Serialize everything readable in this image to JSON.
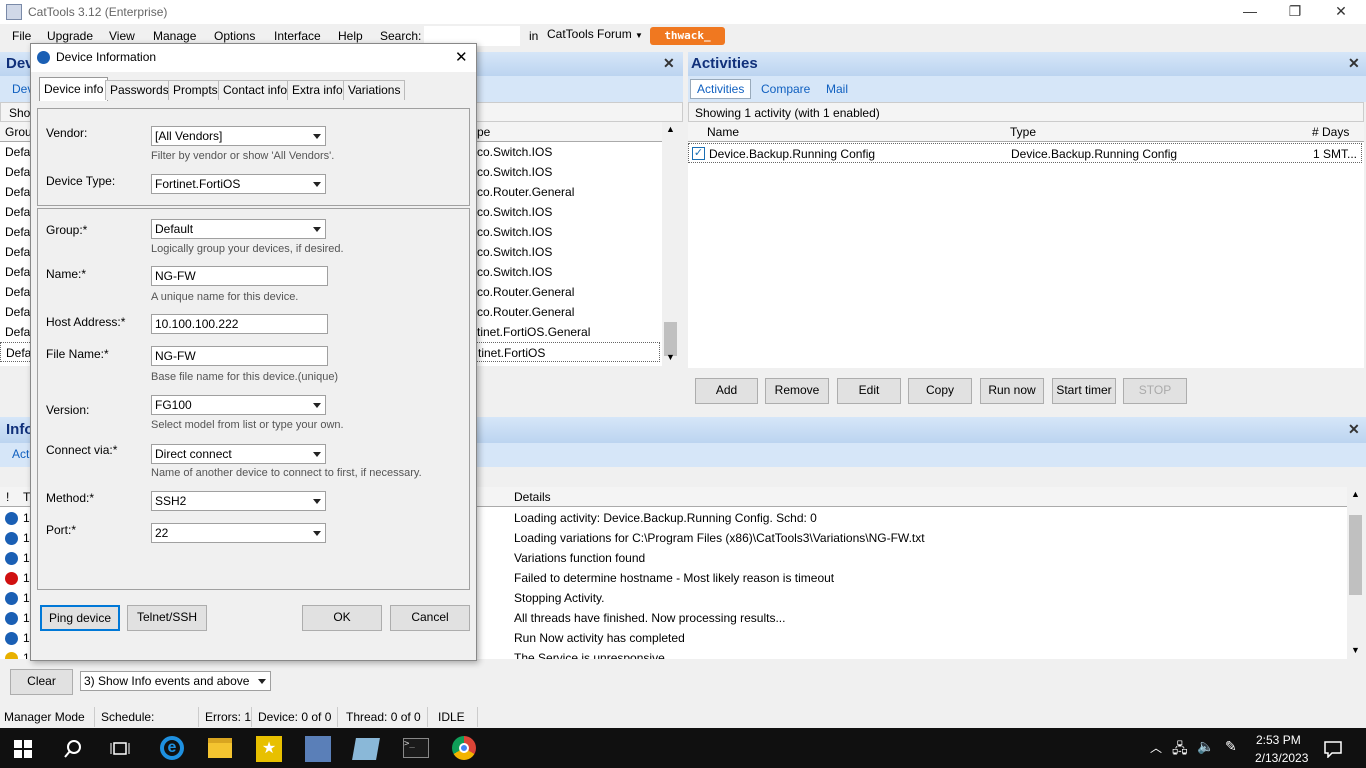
{
  "window": {
    "title": "CatTools 3.12 (Enterprise)",
    "minimize": "—",
    "restore": "❐",
    "close": "✕"
  },
  "menu": {
    "items": [
      "File",
      "Upgrade",
      "View",
      "Manage",
      "Options",
      "Interface",
      "Help"
    ],
    "search_label": "Search:",
    "search_value": "",
    "in_label": "in",
    "in_value": "CatTools Forum",
    "thwack": "thwack_"
  },
  "devices_pane": {
    "title": "Dev",
    "tab": "Dev",
    "show": "Show",
    "col_group": "Grou",
    "col_type": "pe",
    "rows": [
      {
        "group": "Defa",
        "type": "co.Switch.IOS"
      },
      {
        "group": "Defa",
        "type": "co.Switch.IOS"
      },
      {
        "group": "Defa",
        "type": "co.Router.General"
      },
      {
        "group": "Defa",
        "type": "co.Switch.IOS"
      },
      {
        "group": "Defa",
        "type": "co.Switch.IOS"
      },
      {
        "group": "Defa",
        "type": "co.Switch.IOS"
      },
      {
        "group": "Defa",
        "type": "co.Switch.IOS"
      },
      {
        "group": "Defa",
        "type": "co.Router.General"
      },
      {
        "group": "Defa",
        "type": "co.Router.General"
      },
      {
        "group": "Defa",
        "type": "tinet.FortiOS.General"
      },
      {
        "group": "Defa",
        "type": "tinet.FortiOS"
      }
    ]
  },
  "activities": {
    "title": "Activities",
    "tabs": [
      "Activities",
      "Compare",
      "Mail"
    ],
    "showing": "Showing 1 activity (with 1 enabled)",
    "cols": [
      "Name",
      "Type",
      "#",
      "Days"
    ],
    "rows": [
      {
        "name": "Device.Backup.Running Config",
        "type": "Device.Backup.Running Config",
        "num": "1",
        "days": "SMT..."
      }
    ],
    "buttons": [
      "Add",
      "Remove",
      "Edit",
      "Copy",
      "Run now",
      "Start timer",
      "STOP"
    ]
  },
  "info_pane": {
    "title": "Info",
    "tab": "Act",
    "col_excl": "!",
    "col_t": "T",
    "col_details": "Details",
    "rows": [
      {
        "icon": "info",
        "t": "14",
        "details": "Loading activity: Device.Backup.Running Config. Schd: 0"
      },
      {
        "icon": "info",
        "t": "14",
        "details": "Loading variations for  C:\\Program Files (x86)\\CatTools3\\Variations\\NG-FW.txt"
      },
      {
        "icon": "info",
        "t": "14",
        "details": "Variations function found"
      },
      {
        "icon": "error",
        "t": "14",
        "details": "Failed to determine hostname - Most likely reason is timeout"
      },
      {
        "icon": "info",
        "t": "14",
        "details": "Stopping Activity."
      },
      {
        "icon": "info",
        "t": "14",
        "details": "All threads have finished. Now processing results..."
      },
      {
        "icon": "info",
        "t": "14",
        "details": "Run Now activity has completed"
      },
      {
        "icon": "warn",
        "t": "14",
        "details": "The Service is unresponsive"
      }
    ],
    "clear": "Clear",
    "filter": "3) Show Info events and above"
  },
  "status": {
    "mode": "Manager Mode",
    "schedule": "Schedule: Stopped",
    "errors": "Errors: 1",
    "device": "Device: 0 of 0",
    "thread": "Thread: 0 of 0",
    "state": "IDLE"
  },
  "dialog": {
    "title": "Device Information",
    "tabs": [
      "Device info",
      "Passwords",
      "Prompts",
      "Contact info",
      "Extra info",
      "Variations"
    ],
    "vendor_label": "Vendor:",
    "vendor": "[All Vendors]",
    "vendor_hint": "Filter by vendor or show 'All Vendors'.",
    "devtype_label": "Device Type:",
    "devtype": "Fortinet.FortiOS",
    "group_label": "Group:*",
    "group": "Default",
    "group_hint": "Logically group your devices, if desired.",
    "name_label": "Name:*",
    "name": "NG-FW",
    "name_hint": "A unique name for this device.",
    "host_label": "Host Address:*",
    "host": "10.100.100.222",
    "file_label": "File Name:*",
    "file": "NG-FW",
    "file_hint": "Base file name for this device.(unique)",
    "version_label": "Version:",
    "version": "FG100",
    "version_hint": "Select model from list or type your own.",
    "connect_label": "Connect via:*",
    "connect": "Direct connect",
    "connect_hint": "Name of another device to connect to first, if necessary.",
    "method_label": "Method:*",
    "method": "SSH2",
    "port_label": "Port:*",
    "port": "22",
    "buttons": {
      "ping": "Ping device",
      "telnet": "Telnet/SSH",
      "ok": "OK",
      "cancel": "Cancel"
    }
  },
  "taskbar": {
    "time": "2:53 PM",
    "date": "2/13/2023"
  }
}
